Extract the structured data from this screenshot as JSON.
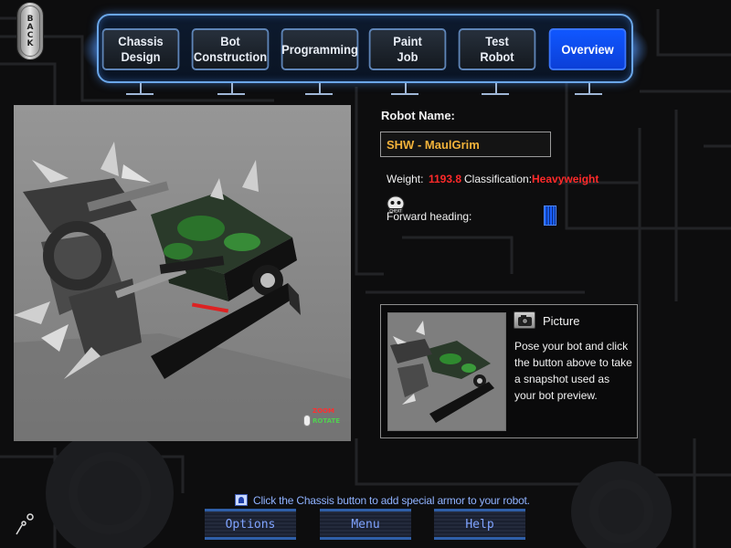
{
  "back_button": {
    "label": "BACK"
  },
  "nav": {
    "tabs": [
      {
        "label_line1": "Chassis",
        "label_line2": "Design",
        "active": false
      },
      {
        "label_line1": "Bot",
        "label_line2": "Construction",
        "active": false
      },
      {
        "label_line1": "Programming",
        "label_line2": "",
        "active": false
      },
      {
        "label_line1": "Paint",
        "label_line2": "Job",
        "active": false
      },
      {
        "label_line1": "Test",
        "label_line2": "Robot",
        "active": false
      },
      {
        "label_line1": "Overview",
        "label_line2": "",
        "active": true
      }
    ]
  },
  "viewport": {
    "zoom_label": "ZOOM",
    "rotate_label": "ROTATE"
  },
  "robot": {
    "name_label": "Robot Name:",
    "name_value": "SHW - MaulGrim",
    "weight_label": "Weight:",
    "weight_value": "1193.8",
    "classification_label": "Classification:",
    "classification_value": "Heavyweight",
    "heading_label": "Forward heading:",
    "skull_label": "CHEAT"
  },
  "picture": {
    "title": "Picture",
    "description": "Pose your bot and click the button above to take a snapshot used as your bot preview."
  },
  "tip": {
    "text": "Click the Chassis button to add special armor to your robot."
  },
  "bottom_buttons": {
    "options": "Options",
    "menu": "Menu",
    "help": "Help"
  },
  "colors": {
    "accent_blue": "#1057ff",
    "value_red": "#ff2a2a",
    "name_gold": "#f2b23a",
    "tip_blue": "#8fb2ff"
  }
}
